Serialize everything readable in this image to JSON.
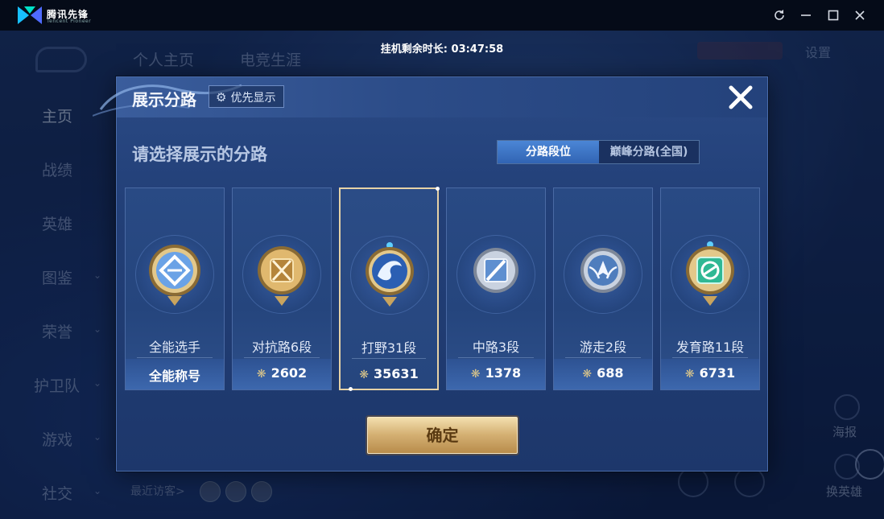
{
  "window": {
    "brand": "腾讯先锋",
    "brand_sub": "Tencent Pioneer",
    "controls": [
      "refresh-icon",
      "minimize-icon",
      "maximize-icon",
      "close-icon"
    ]
  },
  "timer": "挂机剩余时长: 03:47:58",
  "background": {
    "tabs": [
      "个人主页",
      "电竞生涯"
    ],
    "settings": "设置",
    "sidebar": [
      "主页",
      "战绩",
      "英雄",
      "图鉴",
      "荣誉",
      "护卫队",
      "游戏",
      "社交"
    ],
    "visitors_label": "最近访客>",
    "right_labels": [
      "海报",
      "换英雄"
    ]
  },
  "dialog": {
    "title": "展示分路",
    "priority_button": "优先显示",
    "subtitle": "请选择展示的分路",
    "segments": [
      "分路段位",
      "巅峰分路(全国)"
    ],
    "active_segment": "分路段位",
    "confirm": "确定",
    "cards": [
      {
        "role": "全能选手",
        "score": "全能称号",
        "has_points_icon": false,
        "emblem": "all-round",
        "color": "#c9a45e",
        "selected": false
      },
      {
        "role": "对抗路6段",
        "score": "2602",
        "has_points_icon": true,
        "emblem": "clash-lane",
        "color": "#c9a45e",
        "selected": false
      },
      {
        "role": "打野31段",
        "score": "35631",
        "has_points_icon": true,
        "emblem": "jungle",
        "color": "#c9a45e",
        "selected": true
      },
      {
        "role": "中路3段",
        "score": "1378",
        "has_points_icon": true,
        "emblem": "mid-lane",
        "color": "#aeb8c8",
        "selected": false
      },
      {
        "role": "游走2段",
        "score": "688",
        "has_points_icon": true,
        "emblem": "roam",
        "color": "#aeb8c8",
        "selected": false
      },
      {
        "role": "发育路11段",
        "score": "6731",
        "has_points_icon": true,
        "emblem": "farm-lane",
        "color": "#3ec9a6",
        "selected": false
      }
    ]
  },
  "colors": {
    "accent": "#4b86d6",
    "gold": "#d4b073",
    "dialog_bg": "#223f77"
  }
}
